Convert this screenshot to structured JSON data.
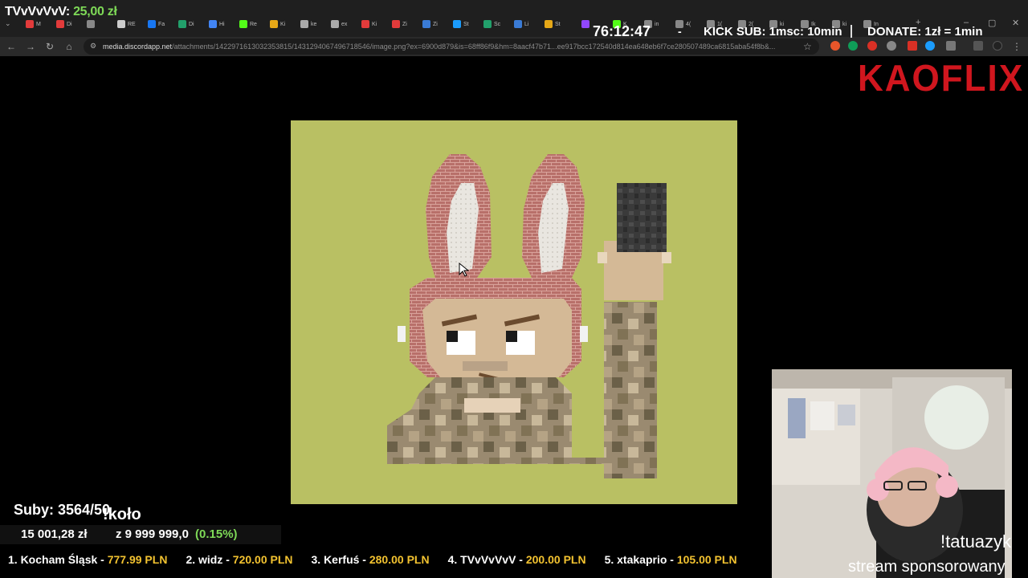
{
  "browser": {
    "tabs_left": [
      {
        "label": "M",
        "color": "#e23b3b"
      },
      {
        "label": "Di",
        "color": "#e23b3b"
      },
      {
        "label": "",
        "color": "#888888"
      },
      {
        "label": "RE",
        "color": "#cccccc"
      },
      {
        "label": "Fa",
        "color": "#1877f2"
      },
      {
        "label": "Di",
        "color": "#22a06b"
      },
      {
        "label": "Hi",
        "color": "#4285f4"
      },
      {
        "label": "Re",
        "color": "#53fc18"
      },
      {
        "label": "Ki",
        "color": "#e6a817"
      },
      {
        "label": "ke",
        "color": "#aaaaaa"
      },
      {
        "label": "ex",
        "color": "#aaaaaa"
      },
      {
        "label": "Ki",
        "color": "#e23b3b"
      },
      {
        "label": "Zi",
        "color": "#e23b3b"
      },
      {
        "label": "Zi",
        "color": "#3a7bd5"
      },
      {
        "label": "St",
        "color": "#1b9cfc"
      },
      {
        "label": "Sc",
        "color": "#22a06b"
      },
      {
        "label": "Li",
        "color": "#3a7bd5"
      },
      {
        "label": "St",
        "color": "#e6a817"
      }
    ],
    "tabs_right": [
      {
        "label": "",
        "color": "#9147ff"
      },
      {
        "label": "K",
        "color": "#53fc18"
      },
      {
        "label": "in",
        "color": "#888888"
      },
      {
        "label": "4(",
        "color": "#888888"
      },
      {
        "label": "1(",
        "color": "#888888"
      },
      {
        "label": "2(",
        "color": "#888888"
      },
      {
        "label": "ki",
        "color": "#888888"
      },
      {
        "label": "Ik",
        "color": "#888888"
      },
      {
        "label": "ki",
        "color": "#888888"
      },
      {
        "label": "In",
        "color": "#888888"
      }
    ],
    "url_host": "media.discordapp.net",
    "url_path": "/attachments/1422971613032353815/1431294067496718546/image.png?ex=6900d879&is=68ff86f9&hm=8aacf47b71...ee917bcc172540d814ea648eb6f7ce280507489ca6815aba54f8b&..."
  },
  "overlay": {
    "donor_name": "TVvVvVvV:",
    "donor_amount": "25,00 zł",
    "timer": "76:12:47",
    "dash": "-",
    "kick_sub": "KICK SUB: 1msc: 10min",
    "donate": "DONATE: 1zł = 1min",
    "logo": "KAOFLIX",
    "subs": "Suby: 3564/50",
    "koto": "!koło",
    "goal_current": "15 001,28 zł",
    "goal_target": "z 9 999 999,0",
    "goal_percent": "(0.15%)",
    "command": "!tatuazyk",
    "sponsor": "stream sponsorowany"
  },
  "leaderboard": [
    {
      "label": "1. Kocham Śląsk -",
      "value": "777.99 PLN"
    },
    {
      "label": "2. widz -",
      "value": "720.00 PLN"
    },
    {
      "label": "3. Kerfuś -",
      "value": "280.00 PLN"
    },
    {
      "label": "4. TVvVvVvV -",
      "value": "200.00 PLN"
    },
    {
      "label": "5. xtakaprio -",
      "value": "105.00 PLN"
    }
  ]
}
